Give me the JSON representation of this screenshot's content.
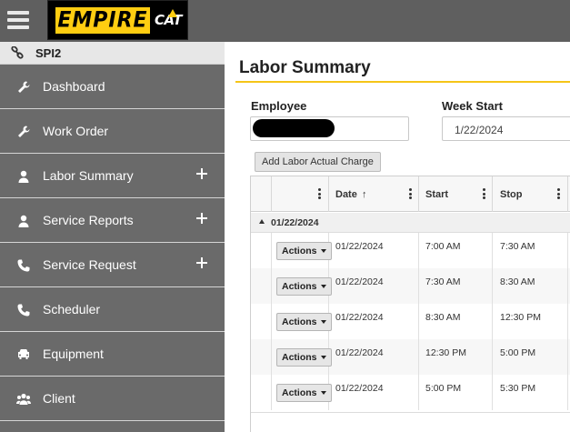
{
  "header": {
    "logo_brand": "EMPIRE",
    "logo_cat": "CAT"
  },
  "sidebar": {
    "header_label": "SPI2",
    "items": [
      {
        "label": "Dashboard",
        "icon": "wrench-icon",
        "expandable": false
      },
      {
        "label": "Work Order",
        "icon": "wrench-icon",
        "expandable": false
      },
      {
        "label": "Labor Summary",
        "icon": "user-icon",
        "expandable": true
      },
      {
        "label": "Service Reports",
        "icon": "user-icon",
        "expandable": true
      },
      {
        "label": "Service Request",
        "icon": "phone-icon",
        "expandable": true
      },
      {
        "label": "Scheduler",
        "icon": "phone-icon",
        "expandable": false
      },
      {
        "label": "Equipment",
        "icon": "car-icon",
        "expandable": false
      },
      {
        "label": "Client",
        "icon": "users-icon",
        "expandable": false
      }
    ]
  },
  "main": {
    "title": "Labor Summary",
    "employee_label": "Employee",
    "week_start_label": "Week Start",
    "week_start_value": "1/22/2024",
    "add_charge_label": "Add Labor Actual Charge",
    "grid": {
      "columns": [
        "Date",
        "Start",
        "Stop"
      ],
      "group_label": "01/22/2024",
      "action_label": "Actions",
      "rows": [
        {
          "date": "01/22/2024",
          "start": "7:00 AM",
          "stop": "7:30 AM"
        },
        {
          "date": "01/22/2024",
          "start": "7:30 AM",
          "stop": "8:30 AM"
        },
        {
          "date": "01/22/2024",
          "start": "8:30 AM",
          "stop": "12:30 PM"
        },
        {
          "date": "01/22/2024",
          "start": "12:30 PM",
          "stop": "5:00 PM"
        },
        {
          "date": "01/22/2024",
          "start": "5:00 PM",
          "stop": "5:30 PM"
        }
      ]
    }
  },
  "colors": {
    "topbar": "#5f5f5f",
    "sidebar": "#6a6a6a",
    "accent_yellow": "#ffcd11",
    "title_rule": "#f5c518"
  }
}
